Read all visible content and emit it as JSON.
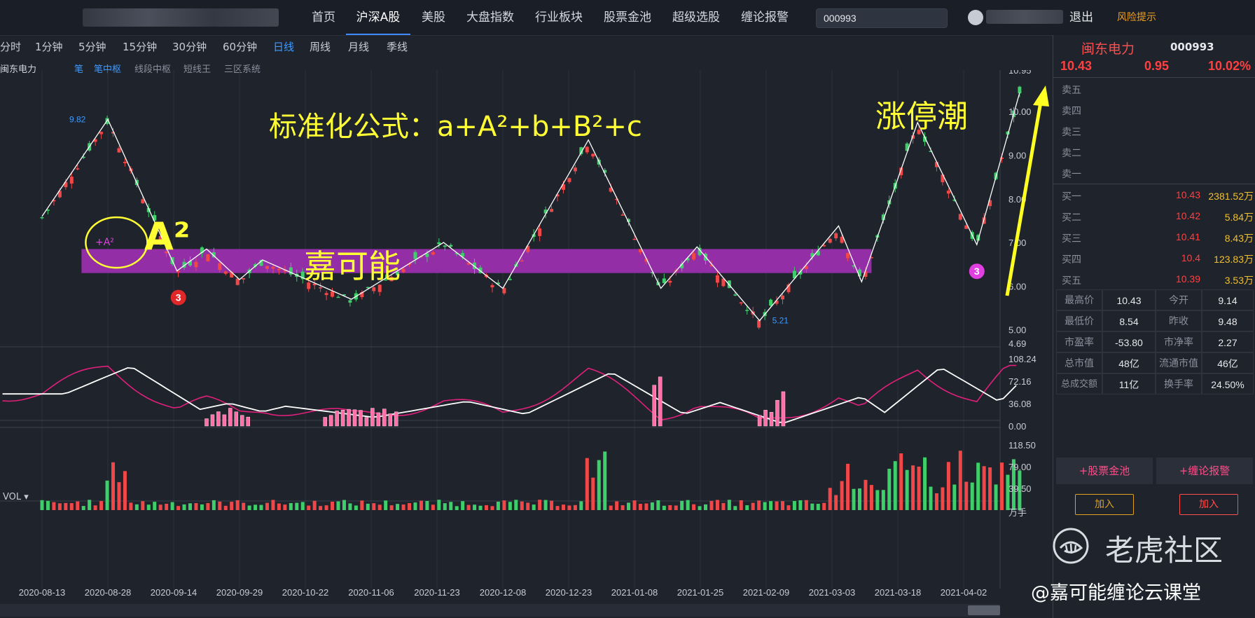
{
  "nav": {
    "items": [
      "首页",
      "沪深A股",
      "美股",
      "大盘指数",
      "行业板块",
      "股票金池",
      "超级选股",
      "缠论报警"
    ],
    "active_index": 1,
    "search_value": "000993",
    "logout_label": "退出",
    "risk_label": "风险提示"
  },
  "periods": {
    "items": [
      "分时",
      "1分钟",
      "5分钟",
      "15分钟",
      "30分钟",
      "60分钟",
      "日线",
      "周线",
      "月线",
      "季线"
    ],
    "active_index": 6
  },
  "indicators": {
    "stock_name": "闽东电力",
    "items": [
      "笔",
      "笔中枢",
      "线段中枢",
      "短线王",
      "三区系统"
    ],
    "active_indices": [
      0,
      1
    ]
  },
  "chart_data": {
    "type": "candlestick",
    "title": "",
    "dates": [
      "2020-08-13",
      "2020-08-28",
      "2020-09-14",
      "2020-09-29",
      "2020-10-22",
      "2020-11-06",
      "2020-11-23",
      "2020-12-08",
      "2020-12-23",
      "2021-01-08",
      "2021-01-25",
      "2021-02-09",
      "2021-03-03",
      "2021-03-18",
      "2021-04-02"
    ],
    "price_axis": [
      "10.95",
      "10.00",
      "9.00",
      "8.00",
      "7.00",
      "6.00",
      "5.00",
      "4.69"
    ],
    "price_range": [
      4.69,
      10.95
    ],
    "pen_points": [
      {
        "d": 0,
        "p": 7.6
      },
      {
        "d": 1.0,
        "p": 9.82
      },
      {
        "d": 2.05,
        "p": 6.35
      },
      {
        "d": 2.5,
        "p": 6.85
      },
      {
        "d": 3.0,
        "p": 6.15
      },
      {
        "d": 3.35,
        "p": 6.6
      },
      {
        "d": 4.7,
        "p": 5.7
      },
      {
        "d": 6.1,
        "p": 7.0
      },
      {
        "d": 7.0,
        "p": 5.95
      },
      {
        "d": 8.3,
        "p": 9.35
      },
      {
        "d": 9.4,
        "p": 5.95
      },
      {
        "d": 9.95,
        "p": 6.9
      },
      {
        "d": 10.9,
        "p": 5.21
      },
      {
        "d": 12.1,
        "p": 7.38
      },
      {
        "d": 12.45,
        "p": 6.1
      },
      {
        "d": 13.3,
        "p": 9.75
      },
      {
        "d": 14.2,
        "p": 6.95
      },
      {
        "d": 14.85,
        "p": 10.43
      }
    ],
    "zhongshu": {
      "upper": 6.85,
      "lower": 6.3,
      "from_d": 0.6,
      "to_d": 12.6
    },
    "annotations": {
      "high_label": "9.82",
      "low_label": "5.21",
      "sell_signal": "3",
      "buy_signal": "3",
      "small_tag": "+A²"
    },
    "macd_axis": [
      "108.24",
      "72.16",
      "36.08",
      "0.00"
    ],
    "vol_axis": [
      "118.50",
      "79.00",
      "39.50"
    ],
    "vol_unit": "万手",
    "vol_label": "VOL"
  },
  "annotations_text": {
    "formula": "标准化公式：a+A²+b+B²+c",
    "a2": "A²",
    "jiakeneng": "嘉可能",
    "zhangtingchao": "涨停潮"
  },
  "quote": {
    "name": "闽东电力",
    "code": "000993",
    "price": "10.43",
    "change": "0.95",
    "pct": "10.02%"
  },
  "orderbook": {
    "asks": [
      {
        "label": "卖五",
        "price": "",
        "vol": ""
      },
      {
        "label": "卖四",
        "price": "",
        "vol": ""
      },
      {
        "label": "卖三",
        "price": "",
        "vol": ""
      },
      {
        "label": "卖二",
        "price": "",
        "vol": ""
      },
      {
        "label": "卖一",
        "price": "",
        "vol": ""
      }
    ],
    "bids": [
      {
        "label": "买一",
        "price": "10.43",
        "vol": "2381.52万"
      },
      {
        "label": "买二",
        "price": "10.42",
        "vol": "5.84万"
      },
      {
        "label": "买三",
        "price": "10.41",
        "vol": "8.43万"
      },
      {
        "label": "买四",
        "price": "10.4",
        "vol": "123.83万"
      },
      {
        "label": "买五",
        "price": "10.39",
        "vol": "3.53万"
      }
    ]
  },
  "stats": [
    {
      "k1": "最高价",
      "v1": "10.43",
      "k2": "今开",
      "v2": "9.14"
    },
    {
      "k1": "最低价",
      "v1": "8.54",
      "k2": "昨收",
      "v2": "9.48"
    },
    {
      "k1": "市盈率",
      "v1": "-53.80",
      "k2": "市净率",
      "v2": "2.27"
    },
    {
      "k1": "总市值",
      "v1": "48亿",
      "k2": "流通市值",
      "v2": "46亿"
    },
    {
      "k1": "总成交额",
      "v1": "11亿",
      "k2": "换手率",
      "v2": "24.50%"
    }
  ],
  "actions": {
    "pool_label": "+股票金池",
    "alert_label": "+缠论报警",
    "add_label_1": "加入",
    "add_label_2": "加入"
  },
  "watermark": {
    "brand": "老虎社区",
    "sub": "@嘉可能缠论云课堂"
  },
  "colors": {
    "up": "#f04848",
    "down": "#3ecf6a",
    "zhongshu": "#9b2fae",
    "annotation": "#ffff33",
    "accent": "#3d9bff"
  }
}
